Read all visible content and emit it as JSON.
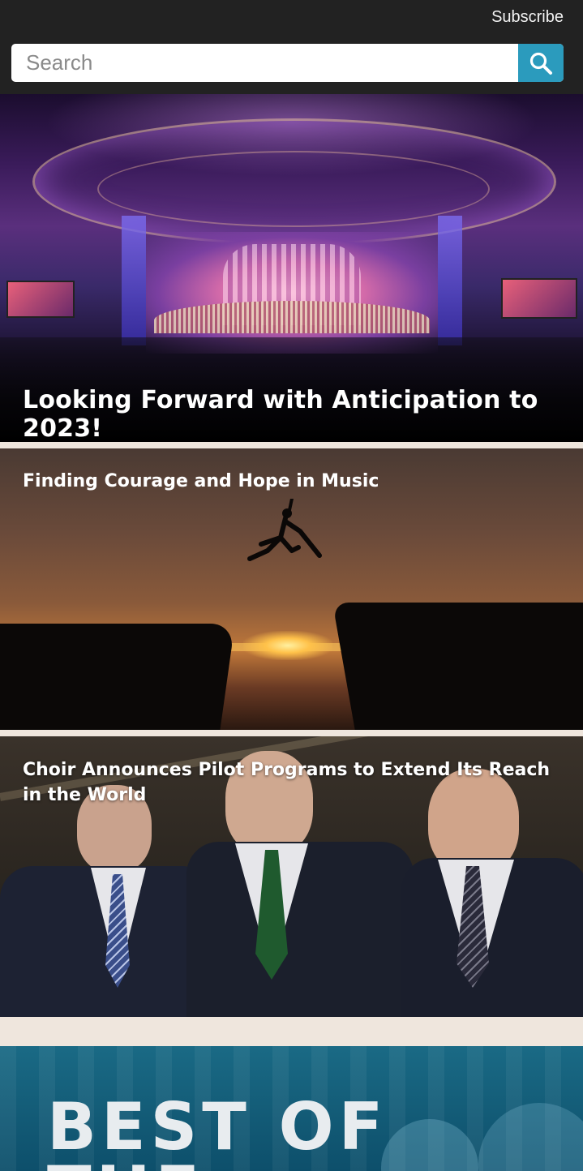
{
  "header": {
    "subscribe_label": "Subscribe",
    "search": {
      "placeholder": "Search",
      "value": ""
    },
    "search_button_icon": "search-icon",
    "accent_color": "#2b9bbd"
  },
  "articles": [
    {
      "title": "Looking Forward with Anticipation to 2023!",
      "image": "concert-hall-photo"
    },
    {
      "title": "Finding Courage and Hope in Music",
      "image": "cliff-jump-sunset-photo"
    },
    {
      "title": "Choir Announces Pilot Programs to Extend Its Reach in the World",
      "image": "three-men-portrait-photo"
    },
    {
      "title": "",
      "image": "best-of-banner",
      "banner_text_line1": "BEST OF",
      "banner_text_line2": "THE"
    }
  ]
}
